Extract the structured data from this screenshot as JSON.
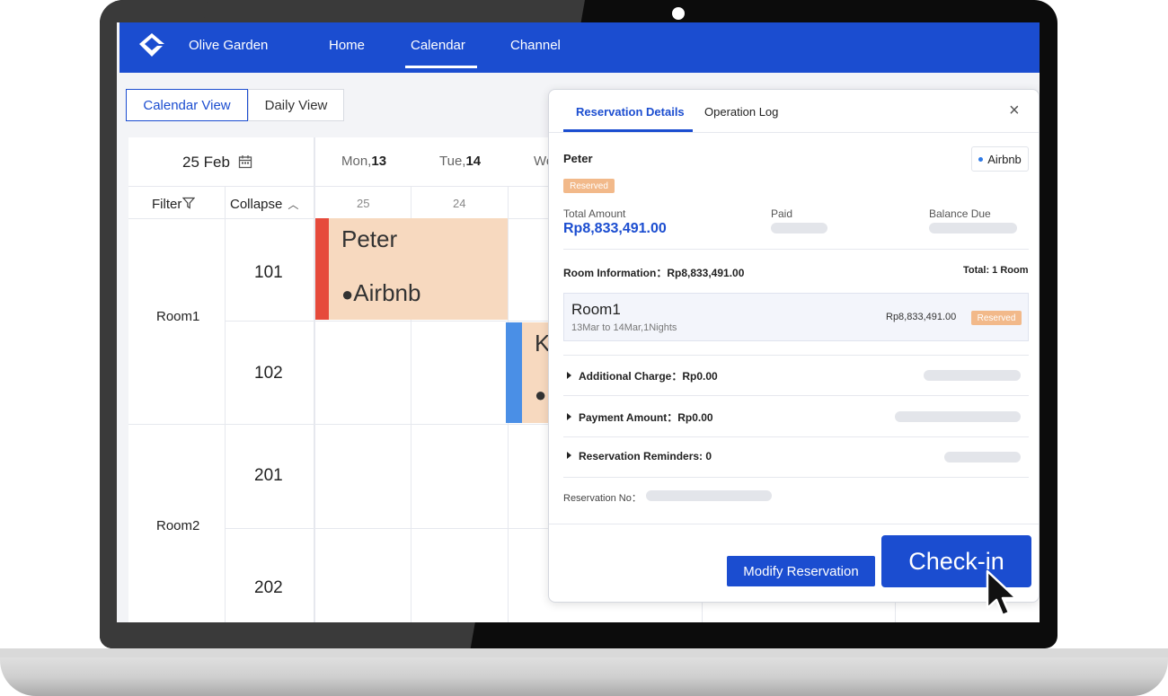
{
  "app": {
    "brand": "Olive Garden",
    "nav": [
      "Home",
      "Calendar",
      "Channel"
    ],
    "active_nav": "Calendar",
    "accent_color": "#1b4dd0"
  },
  "views": {
    "calendar_view": "Calendar View",
    "daily_view": "Daily View",
    "active": "Calendar View"
  },
  "calendar": {
    "date": "25 Feb",
    "days": [
      {
        "dow": "Mon,",
        "num": "13"
      },
      {
        "dow": "Tue,",
        "num": "14"
      },
      {
        "dow": "We",
        "num": ""
      }
    ],
    "day_numbers": [
      "25",
      "24"
    ],
    "filter_label": "Filter",
    "collapse_label": "Collapse",
    "room_types": [
      {
        "name": "Room1",
        "rooms": [
          "101",
          "102"
        ]
      },
      {
        "name": "Room2",
        "rooms": [
          "201",
          "202"
        ]
      }
    ],
    "bookings": [
      {
        "guest": "Peter",
        "source": "Airbnb",
        "bar_color": "#e64a3b"
      },
      {
        "guest": "K",
        "source": "",
        "bar_color": "#4a8fe6"
      }
    ]
  },
  "panel": {
    "tabs": [
      "Reservation Details",
      "Operation Log"
    ],
    "active_tab": "Reservation Details",
    "close_icon": "close-icon",
    "guest_name": "Peter",
    "source": "Airbnb",
    "status": "Reserved",
    "total_amount_label": "Total Amount",
    "total_amount": "Rp8,833,491.00",
    "paid_label": "Paid",
    "balance_label": "Balance Due",
    "room_info_label": "Room Information：Rp8,833,491.00",
    "room_total": "Total: 1 Room",
    "room": {
      "name": "Room1",
      "dates": "13Mar to 14Mar,1Nights",
      "price": "Rp8,833,491.00",
      "status": "Reserved"
    },
    "additional_charge": "Additional Charge：Rp0.00",
    "payment_amount": "Payment Amount：Rp0.00",
    "reminders": "Reservation Reminders: 0",
    "reservation_no_label": "Reservation No：",
    "modify_button": "Modify Reservation"
  },
  "checkin_button": "Check-in"
}
